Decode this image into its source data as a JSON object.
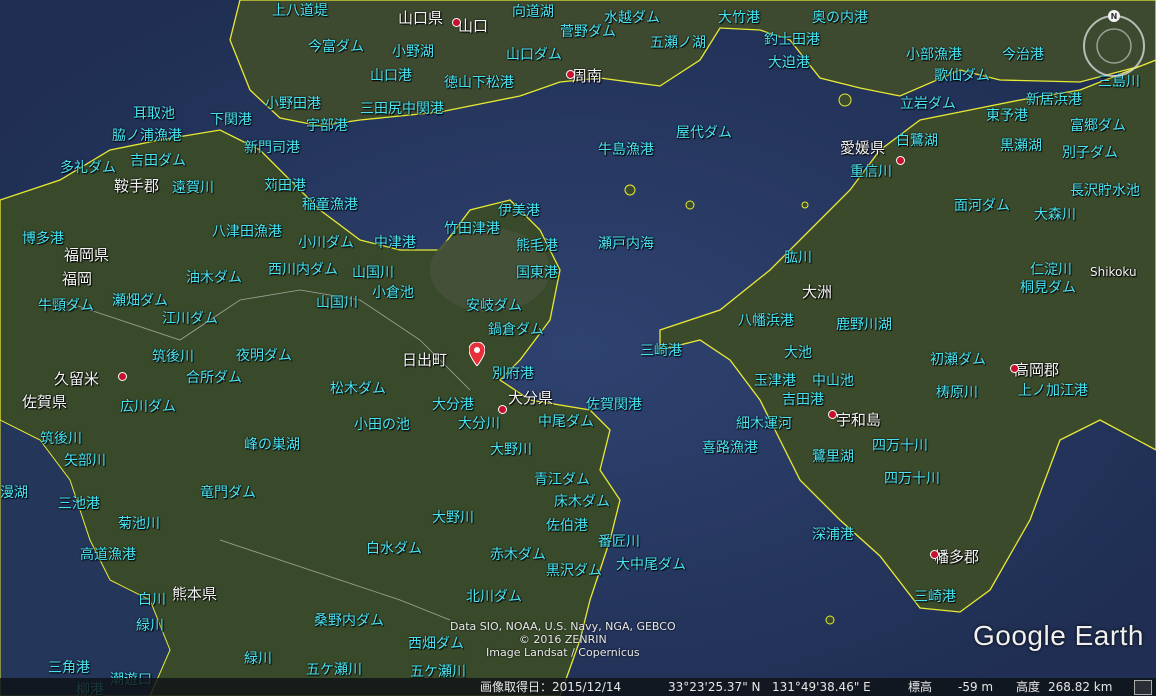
{
  "map": {
    "attribution_lines": [
      "Data SIO, NOAA, U.S. Navy, NGA, GEBCO",
      "© 2016 ZENRIN",
      "Image Landsat / Copernicus"
    ],
    "logo_text": "Google Earth",
    "compass_label": "N",
    "colors": {
      "sea": "#26365c",
      "land": "#3a4a2e",
      "coast": "#e8ea34",
      "label": "#49e4f3"
    }
  },
  "labels": {
    "kamihachi": "上八道堤",
    "yamaguchi_ken": "山口県",
    "yamaguchi": "山口",
    "kouko": "向道湖",
    "mizukoshi": "水越ダム",
    "ootake": "大竹港",
    "okunouchi": "奥の内港",
    "imatomi": "今富ダム",
    "onoko": "小野湖",
    "sugano": "菅野ダム",
    "gosekozu": "五瀬ノ湖",
    "tsurishi": "釣士田港",
    "kobe_gyo": "小部漁港",
    "imaharu": "今治港",
    "yamaguchi_port": "山口港",
    "tokuyama": "徳山下松港",
    "yamaguchi_dam": "山口ダム",
    "shunan": "周南",
    "oosako": "大迫港",
    "kasen": "歌仙ダム",
    "mishima": "三島川",
    "mimitori": "耳取池",
    "shimonoseki": "下関港",
    "onoda": "小野田港",
    "mitajiri": "三田尻中関港",
    "tateiwa": "立岩ダム",
    "toyoko": "東予港",
    "niihama": "新居浜港",
    "wakinoura": "脇ノ浦漁港",
    "ube": "宇部港",
    "yashiro": "屋代ダム",
    "shirasagi": "白鷺湖",
    "tomigo": "富郷ダム",
    "tarei": "多礼ダム",
    "yoshida": "吉田ダム",
    "shinmoji": "新門司港",
    "ushijima": "牛島漁港",
    "ehime": "愛媛県",
    "kurose": "黒瀬湖",
    "besshiko": "別子ダム",
    "kurate": "鞍手郡",
    "onga": "遠賀川",
    "kanda": "苅田港",
    "shigenobu": "重信川",
    "nagasawa": "長沢貯水池",
    "inazumi": "稲童漁港",
    "imi": "伊美港",
    "omogo": "面河ダム",
    "oomori": "大森川",
    "hakata": "博多港",
    "yatsuda": "八津田漁港",
    "kogawa": "小川ダム",
    "nakatsu": "中津港",
    "taketa": "竹田津港",
    "kumage": "熊毛港",
    "seto": "瀬戸内海",
    "fukuoka_ken": "福岡県",
    "fukuoka": "福岡",
    "abura": "油木ダム",
    "nishikawa": "西川内ダム",
    "yamakuni": "山国川",
    "kunisaki": "国東港",
    "hiji_r": "肱川",
    "niyodo": "仁淀川",
    "shikoku": "Shikoku",
    "ushikubi": "牛頸ダム",
    "sebata": "瀬畑ダム",
    "yamakuni2": "山国川",
    "ogura": "小倉池",
    "aki": "安岐ダム",
    "ozu": "大洲",
    "kirimi": "桐見ダム",
    "egawa": "江川ダム",
    "nabekura": "鍋倉ダム",
    "yawatahama": "八幡浜港",
    "kanogawa": "鹿野川湖",
    "chikugo": "筑後川",
    "yoake": "夜明ダム",
    "hiji": "日出町",
    "misaki": "三崎港",
    "oike": "大池",
    "hatsuse": "初瀬ダム",
    "takaoka": "高岡郡",
    "kurume": "久留米",
    "goudo": "合所ダム",
    "matsuki": "松木ダム",
    "beppu": "別府港",
    "tamazu": "玉津港",
    "nakayama": "中山池",
    "yusuhara": "梼原川",
    "kaminokae": "上ノ加江港",
    "saga": "佐賀県",
    "hirokawa": "広川ダム",
    "oita_port": "大分港",
    "oita_ken": "大分県",
    "sagaseki": "佐賀関港",
    "yoshida_port": "吉田港",
    "odanoike": "小田の池",
    "oita_r": "大分川",
    "nakao": "中尾ダム",
    "hosoki": "細木運河",
    "uwajima": "宇和島",
    "chikugo2": "筑後川",
    "minenosu": "峰の巣湖",
    "ono_r": "大野川",
    "kiro": "喜路漁港",
    "sato": "鷺里湖",
    "shimanto": "四万十川",
    "yabe": "矢部川",
    "aoe": "青江ダム",
    "shimanto2": "四万十川",
    "ryomon": "竜門ダム",
    "tokoki": "床木ダム",
    "miike": "三池港",
    "ikechi": "菊池川",
    "onogawa2": "大野川",
    "saiki": "佐伯港",
    "fukaura": "深浦港",
    "bansho": "番匠川",
    "takase": "高道漁港",
    "shirasui": "白水ダム",
    "akagi": "赤木ダム",
    "hata": "幡多郡",
    "ookanoo": "大中尾ダム",
    "kurosawa": "黒沢ダム",
    "kumamoto": "熊本県",
    "misaki2": "三崎港",
    "shiro": "白川",
    "kitagawa": "北川ダム",
    "kuwano": "桑野内ダム",
    "midori": "緑川",
    "nishihata": "西畑ダム",
    "midori2": "緑川",
    "gokase": "五ケ瀬川",
    "gokase2": "五ケ瀬川",
    "misumi": "三角港",
    "shiomi": "潮遊口",
    "sakuraha": "柳港",
    "manjuku": "漫湖"
  },
  "status": {
    "date_label": "画像取得日：2015/12/14",
    "lat": "33°23'25.37\" N",
    "lon": "131°49'38.46\" E",
    "elev_label": "標高",
    "elev_value": "-59 m",
    "alt_label": "高度",
    "alt_value": "268.82 km"
  }
}
